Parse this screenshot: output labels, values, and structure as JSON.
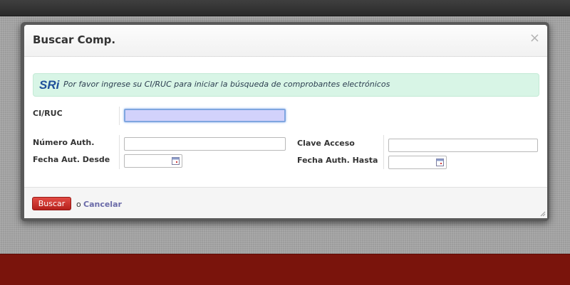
{
  "modal": {
    "title": "Buscar Comp.",
    "close_symbol": "×"
  },
  "alert": {
    "logo_text": "SRi",
    "message": "Por favor ingrese su CI/RUC para iniciar la búsqueda de comprobantes electrónicos"
  },
  "form": {
    "ci_ruc_label": "CI/RUC",
    "ci_ruc_value": "",
    "numero_auth_label": "Número Auth.",
    "numero_auth_value": "",
    "clave_acceso_label": "Clave Acceso",
    "clave_acceso_value": "",
    "fecha_desde_label": "Fecha Aut. Desde",
    "fecha_desde_value": "",
    "fecha_hasta_label": "Fecha Auth. Hasta",
    "fecha_hasta_value": ""
  },
  "footer": {
    "buscar_label": "Buscar",
    "or_text": "o",
    "cancel_label": "Cancelar"
  },
  "icons": {
    "close": "close-icon",
    "calendar": "calendar-icon",
    "logo": "sri-logo",
    "resize": "resize-handle-icon"
  },
  "colors": {
    "footer_band": "#7a140c",
    "alert_bg": "#d8f5e6",
    "primary_button": "#c8302a",
    "focused_input": "#d2d2fb",
    "cancel_link": "#6a6aa8"
  }
}
